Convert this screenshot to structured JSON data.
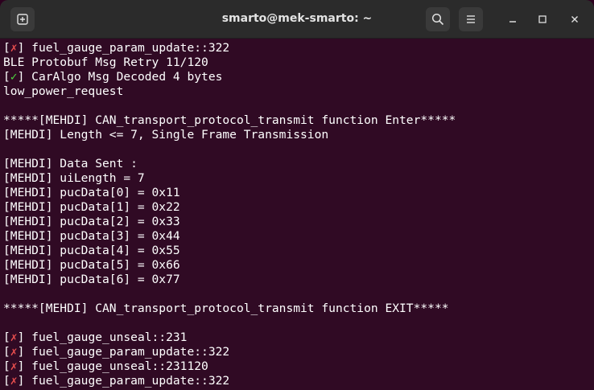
{
  "window": {
    "title": "smarto@mek-smarto: ~"
  },
  "titlebar": {
    "new_tab_icon": "new-tab-icon",
    "search_icon": "search-icon",
    "menu_icon": "hamburger-menu-icon",
    "minimize_icon": "minimize-icon",
    "maximize_icon": "maximize-icon",
    "close_icon": "close-icon"
  },
  "terminal": {
    "lines": [
      {
        "pre": "[",
        "mark": "✗",
        "post": "] fuel_gauge_param_update::322",
        "mark_type": "fail"
      },
      {
        "text": "BLE Protobuf Msg Retry 11/120"
      },
      {
        "pre": "[",
        "mark": "✓",
        "post": "] CarAlgo Msg Decoded 4 bytes",
        "mark_type": "ok"
      },
      {
        "text": "low_power_request"
      },
      {
        "text": ""
      },
      {
        "text": "*****[MEHDI] CAN_transport_protocol_transmit function Enter*****"
      },
      {
        "text": "[MEHDI] Length <= 7, Single Frame Transmission"
      },
      {
        "text": ""
      },
      {
        "text": "[MEHDI] Data Sent :"
      },
      {
        "text": "[MEHDI] uiLength = 7"
      },
      {
        "text": "[MEHDI] pucData[0] = 0x11"
      },
      {
        "text": "[MEHDI] pucData[1] = 0x22"
      },
      {
        "text": "[MEHDI] pucData[2] = 0x33"
      },
      {
        "text": "[MEHDI] pucData[3] = 0x44"
      },
      {
        "text": "[MEHDI] pucData[4] = 0x55"
      },
      {
        "text": "[MEHDI] pucData[5] = 0x66"
      },
      {
        "text": "[MEHDI] pucData[6] = 0x77"
      },
      {
        "text": ""
      },
      {
        "text": "*****[MEHDI] CAN_transport_protocol_transmit function EXIT*****"
      },
      {
        "text": ""
      },
      {
        "pre": "[",
        "mark": "✗",
        "post": "] fuel_gauge_unseal::231",
        "mark_type": "fail"
      },
      {
        "pre": "[",
        "mark": "✗",
        "post": "] fuel_gauge_param_update::322",
        "mark_type": "fail"
      },
      {
        "pre": "[",
        "mark": "✗",
        "post": "] fuel_gauge_unseal::231120",
        "mark_type": "fail"
      },
      {
        "pre": "[",
        "mark": "✗",
        "post": "] fuel_gauge_param_update::322",
        "mark_type": "fail"
      }
    ]
  },
  "colors": {
    "terminal_bg": "#300a24",
    "titlebar_bg": "#2b2b2b",
    "fail_mark": "#e84e4e",
    "ok_mark": "#4bd33e",
    "text": "#ffffff"
  }
}
